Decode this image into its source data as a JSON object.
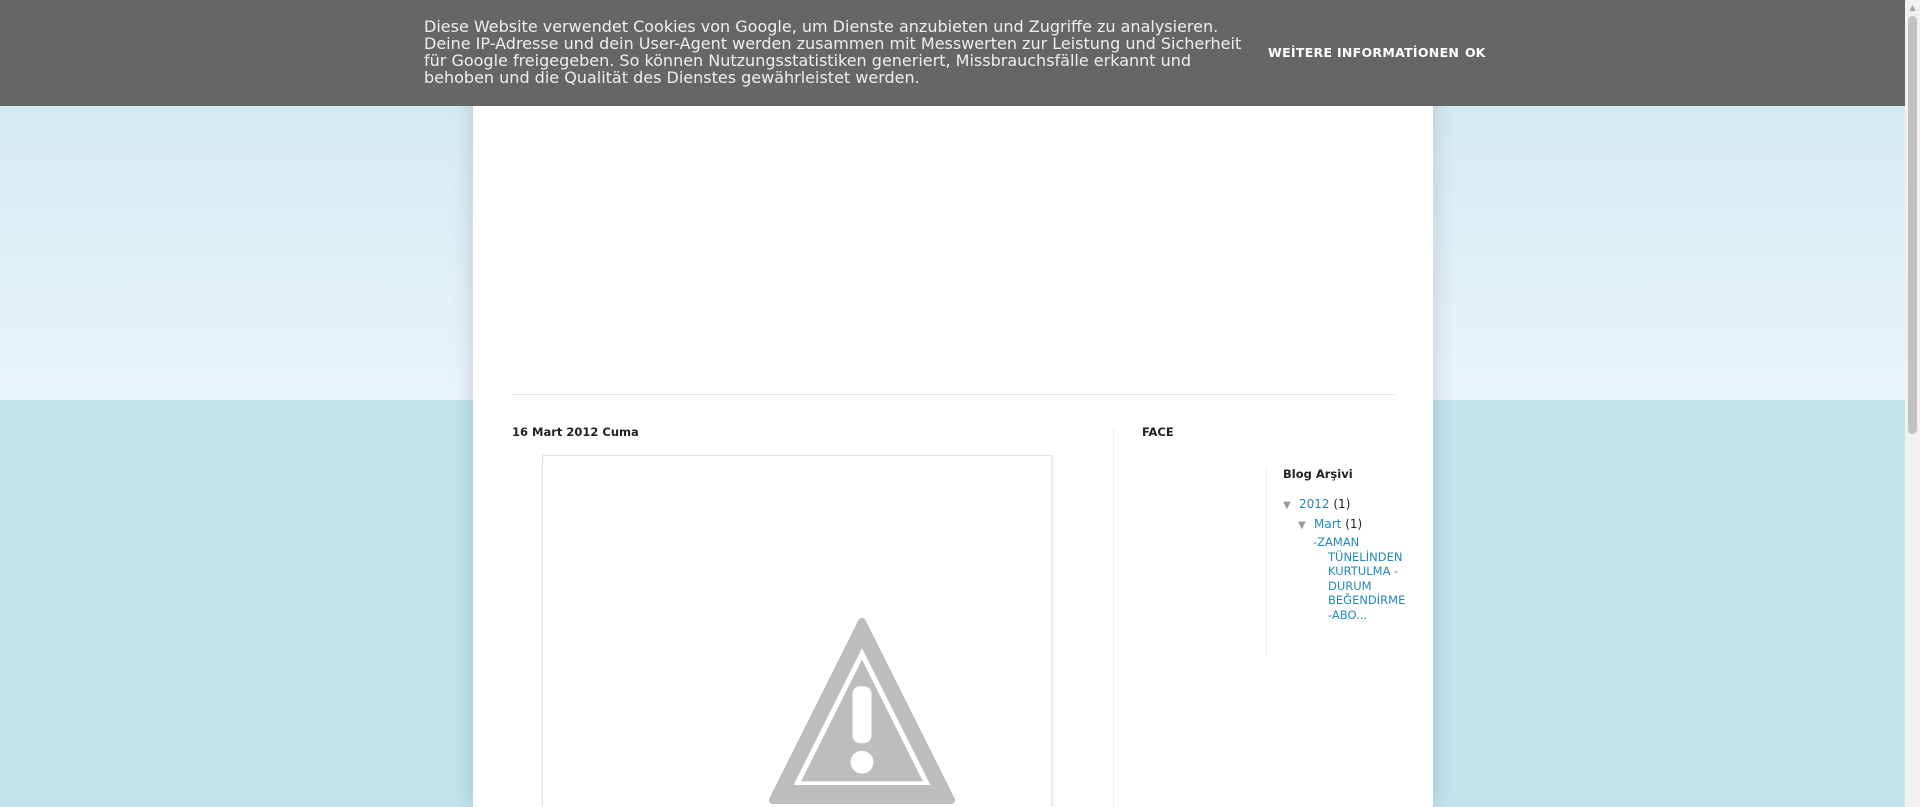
{
  "cookie_bar": {
    "message": "Diese Website verwendet Cookies von Google, um Dienste anzubieten und Zugriffe zu analysieren. Deine IP-Adresse und dein User-Agent werden zusammen mit Messwerten zur Leistung und Sicherheit für Google freigegeben. So können Nutzungsstatistiken generiert, Missbrauchsfälle erkannt und behoben und die Qualität des Dienstes gewährleistet werden.",
    "more_info_label": "WEİTERE INFORMATİONEN",
    "ok_label": "OK"
  },
  "post": {
    "date": "16 Mart 2012 Cuma",
    "image_icon": "warning-icon"
  },
  "sidebar": {
    "face_title": "FACE",
    "archive": {
      "title": "Blog Arşivi",
      "year": {
        "toggle": "▼",
        "label": "2012",
        "count": "(1)"
      },
      "month": {
        "toggle": "▼",
        "label": "Mart",
        "count": "(1)"
      },
      "post_title": "-ZAMAN TÜNELİNDEN KURTULMA -DURUM BEĞENDİRME -ABO..."
    }
  },
  "colors": {
    "cookie_bar": "#666666",
    "link": "#2288bb",
    "background": "#c3e3ee"
  }
}
